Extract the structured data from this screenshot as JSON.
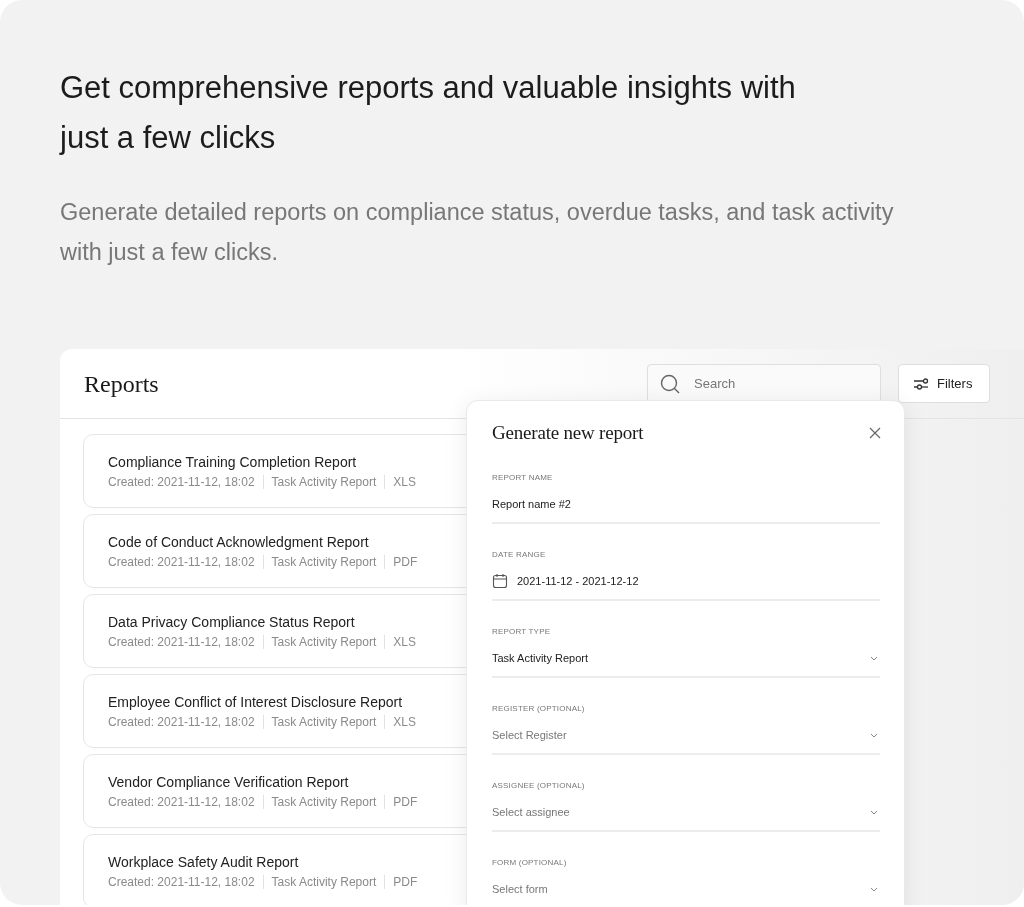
{
  "hero": {
    "title": "Get comprehensive reports and valuable insights with just a few clicks",
    "subtitle": "Generate detailed reports on compliance status, overdue tasks, and task activity with just a few clicks."
  },
  "reports": {
    "title": "Reports",
    "search": {
      "placeholder": "Search"
    },
    "filters_button": "Filters",
    "items": [
      {
        "name": "Compliance Training Completion Report",
        "created": "Created: 2021-11-12, 18:02",
        "type": "Task Activity Report",
        "format": "XLS"
      },
      {
        "name": "Code of Conduct Acknowledgment Report",
        "created": "Created: 2021-11-12, 18:02",
        "type": "Task Activity Report",
        "format": "PDF"
      },
      {
        "name": "Data Privacy Compliance Status Report",
        "created": "Created: 2021-11-12, 18:02",
        "type": "Task Activity Report",
        "format": "XLS"
      },
      {
        "name": "Employee Conflict of Interest Disclosure Report",
        "created": "Created: 2021-11-12, 18:02",
        "type": "Task Activity Report",
        "format": "XLS"
      },
      {
        "name": "Vendor Compliance Verification Report",
        "created": "Created: 2021-11-12, 18:02",
        "type": "Task Activity Report",
        "format": "PDF"
      },
      {
        "name": "Workplace Safety Audit Report",
        "created": "Created: 2021-11-12, 18:02",
        "type": "Task Activity Report",
        "format": "PDF"
      }
    ]
  },
  "modal": {
    "title": "Generate new report",
    "fields": [
      {
        "kind": "text",
        "label": "REPORT NAME",
        "value": "Report name #2"
      },
      {
        "kind": "date",
        "label": "DATE RANGE",
        "value": "2021-11-12 - 2021-12-12"
      },
      {
        "kind": "select",
        "label": "REPORT TYPE",
        "value": "Task Activity Report"
      },
      {
        "kind": "select",
        "label": "REGISTER (OPTIONAL)",
        "placeholder": "Select Register"
      },
      {
        "kind": "select",
        "label": "ASSIGNEE (OPTIONAL)",
        "placeholder": "Select assignee"
      },
      {
        "kind": "select",
        "label": "FORM (OPTIONAL)",
        "placeholder": "Select form"
      }
    ]
  }
}
